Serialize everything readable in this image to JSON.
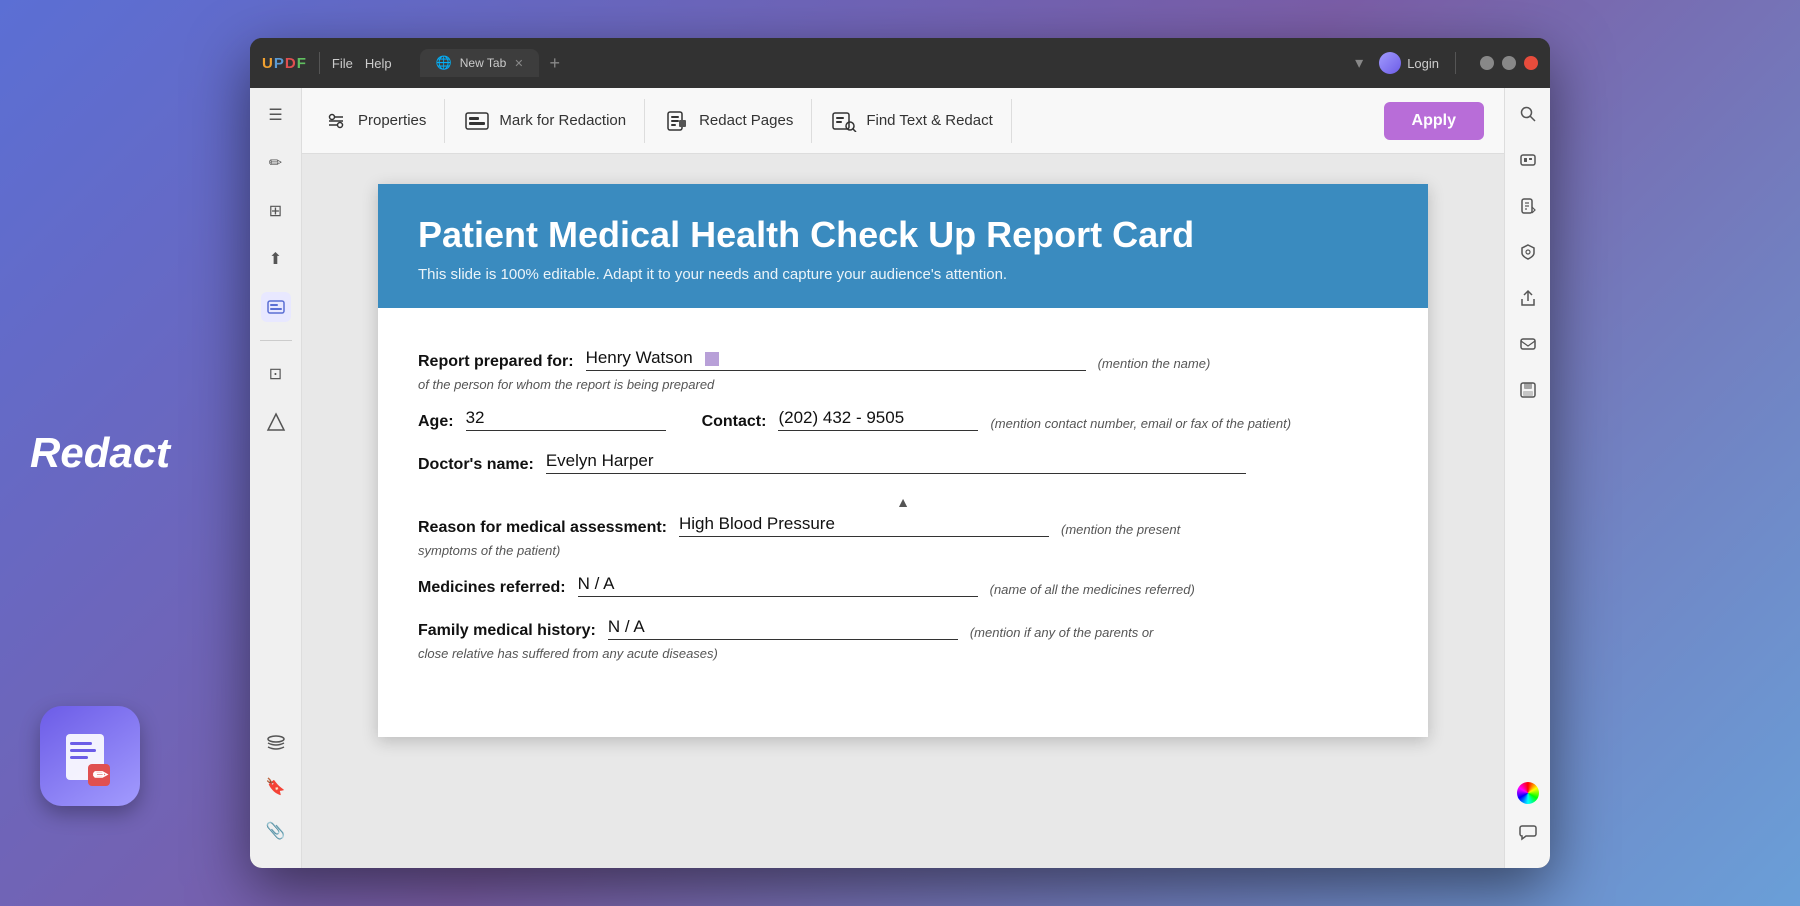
{
  "app": {
    "brand": "UPDF",
    "menu_file": "File",
    "menu_help": "Help",
    "tab_label": "New Tab",
    "login_label": "Login"
  },
  "redact_label": "Redact",
  "toolbar": {
    "properties_label": "Properties",
    "mark_redaction_label": "Mark for Redaction",
    "redact_pages_label": "Redact Pages",
    "find_text_redact_label": "Find Text & Redact",
    "apply_label": "Apply"
  },
  "report": {
    "title": "Patient Medical Health Check Up Report Card",
    "subtitle": "This slide is 100% editable. Adapt it to your needs and capture your audience's attention.",
    "report_prepared_for_label": "Report prepared for:",
    "patient_name": "Henry Watson",
    "name_hint": "(mention the name)",
    "name_sub_hint": "of the person for whom the report is being prepared",
    "age_label": "Age:",
    "age_value": "32",
    "contact_label": "Contact:",
    "contact_value": "(202) 432 - 9505",
    "contact_hint": "(mention contact number, email or fax of the patient)",
    "doctor_label": "Doctor's name:",
    "doctor_value": "Evelyn  Harper",
    "reason_label": "Reason for medical assessment:",
    "reason_value": "High Blood Pressure",
    "reason_hint": "(mention the present",
    "reason_sub_hint": "symptoms of the patient)",
    "medicines_label": "Medicines referred:",
    "medicines_value": "N / A",
    "medicines_hint": "(name of all the medicines referred)",
    "family_label": "Family medical history:",
    "family_value": "N / A",
    "family_hint": "(mention if any of the parents or",
    "family_sub_hint": "close relative has suffered from any acute diseases)"
  },
  "sidebar": {
    "items": [
      {
        "name": "thumbnails",
        "icon": "☰"
      },
      {
        "name": "annotate",
        "icon": "✏"
      },
      {
        "name": "organize",
        "icon": "⊞"
      },
      {
        "name": "export",
        "icon": "⬆"
      },
      {
        "name": "redact-active",
        "icon": "▣"
      },
      {
        "name": "stamp",
        "icon": "⊡"
      },
      {
        "name": "compare",
        "icon": "⬡"
      }
    ]
  },
  "right_toolbar": {
    "items": [
      {
        "name": "search",
        "icon": "🔍"
      },
      {
        "name": "ocr",
        "icon": "T"
      },
      {
        "name": "extract",
        "icon": "📄"
      },
      {
        "name": "secure",
        "icon": "🔒"
      },
      {
        "name": "share",
        "icon": "↑"
      },
      {
        "name": "email",
        "icon": "✉"
      },
      {
        "name": "save",
        "icon": "💾"
      }
    ]
  }
}
